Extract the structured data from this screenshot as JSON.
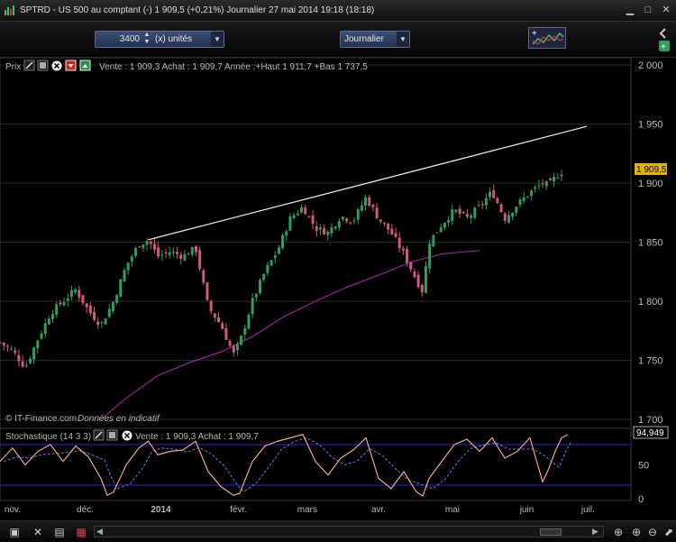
{
  "window": {
    "title": "SPTRD - US 500 au comptant (-)    1 909,5 (+0,21%)    Journalier  27 mai 2014 19:18 (18:18)"
  },
  "toolbar": {
    "quantity": "3400",
    "units_label": "(x) unités",
    "period": "Journalier"
  },
  "price_panel": {
    "label": "Prix",
    "header": "Vente : 1 909,3 Achat : 1 909,7 Année :+Haut 1 911,7 +Bas 1 737,5",
    "last_price": "1 909,5",
    "watermark": "© IT-Finance.com",
    "watermark_note": "Données en indicatif"
  },
  "stoch_panel": {
    "label": "Stochastique (14 3 3)",
    "header": "Vente : 1 909,3 Achat : 1 909,7",
    "last_value": "94,949"
  },
  "colors": {
    "up": "#2e9e5b",
    "down": "#d05a7a",
    "ma": "#9b1f9b",
    "trend": "#e6e6e6",
    "stoch_k": "#f2a58c",
    "stoch_d": "#7070ff",
    "bands": "#2b2bd0"
  },
  "chart_data": [
    {
      "type": "candlestick",
      "series_name": "SPTRD",
      "x_ticks": [
        "nov.",
        "déc.",
        "2014",
        "févr.",
        "mars",
        "avr.",
        "mai",
        "juin",
        "juil."
      ],
      "y_ticks": [
        "2 000",
        "1 950",
        "1 900",
        "1 850",
        "1 800",
        "1 750",
        "1 700"
      ],
      "ylim": [
        1700,
        2000
      ],
      "grid": true,
      "moving_average": [
        [
          0.16,
          1700
        ],
        [
          0.2,
          1718
        ],
        [
          0.25,
          1737
        ],
        [
          0.3,
          1748
        ],
        [
          0.35,
          1757
        ],
        [
          0.4,
          1770
        ],
        [
          0.45,
          1787
        ],
        [
          0.5,
          1800
        ],
        [
          0.55,
          1812
        ],
        [
          0.6,
          1822
        ],
        [
          0.65,
          1833
        ],
        [
          0.7,
          1840
        ],
        [
          0.76,
          1843
        ]
      ],
      "trend_line": [
        [
          0.235,
          1852
        ],
        [
          0.93,
          1948
        ]
      ],
      "close_path": [
        [
          0.0,
          1765
        ],
        [
          0.02,
          1758
        ],
        [
          0.04,
          1744
        ],
        [
          0.06,
          1768
        ],
        [
          0.08,
          1790
        ],
        [
          0.1,
          1800
        ],
        [
          0.12,
          1810
        ],
        [
          0.14,
          1792
        ],
        [
          0.16,
          1780
        ],
        [
          0.18,
          1800
        ],
        [
          0.2,
          1830
        ],
        [
          0.22,
          1848
        ],
        [
          0.235,
          1852
        ],
        [
          0.25,
          1838
        ],
        [
          0.27,
          1842
        ],
        [
          0.29,
          1838
        ],
        [
          0.31,
          1845
        ],
        [
          0.33,
          1795
        ],
        [
          0.35,
          1780
        ],
        [
          0.37,
          1755
        ],
        [
          0.38,
          1765
        ],
        [
          0.4,
          1800
        ],
        [
          0.42,
          1825
        ],
        [
          0.44,
          1843
        ],
        [
          0.46,
          1870
        ],
        [
          0.48,
          1880
        ],
        [
          0.5,
          1862
        ],
        [
          0.52,
          1858
        ],
        [
          0.54,
          1872
        ],
        [
          0.56,
          1868
        ],
        [
          0.58,
          1888
        ],
        [
          0.6,
          1870
        ],
        [
          0.62,
          1858
        ],
        [
          0.64,
          1840
        ],
        [
          0.66,
          1818
        ],
        [
          0.67,
          1808
        ],
        [
          0.68,
          1850
        ],
        [
          0.7,
          1865
        ],
        [
          0.72,
          1877
        ],
        [
          0.74,
          1870
        ],
        [
          0.76,
          1880
        ],
        [
          0.78,
          1893
        ],
        [
          0.8,
          1870
        ],
        [
          0.82,
          1882
        ],
        [
          0.84,
          1892
        ],
        [
          0.86,
          1900
        ],
        [
          0.87,
          1898
        ],
        [
          0.88,
          1905
        ],
        [
          0.89,
          1909.5
        ]
      ]
    },
    {
      "type": "line",
      "series_name": "Stochastique (14 3 3)",
      "y_ticks": [
        "50",
        "0"
      ],
      "bands": [
        80,
        20
      ],
      "last_value": "94,949",
      "k_path": [
        [
          0.0,
          55
        ],
        [
          0.02,
          75
        ],
        [
          0.04,
          50
        ],
        [
          0.06,
          70
        ],
        [
          0.08,
          80
        ],
        [
          0.1,
          55
        ],
        [
          0.12,
          78
        ],
        [
          0.14,
          62
        ],
        [
          0.16,
          30
        ],
        [
          0.17,
          5
        ],
        [
          0.18,
          10
        ],
        [
          0.2,
          50
        ],
        [
          0.22,
          75
        ],
        [
          0.235,
          85
        ],
        [
          0.25,
          65
        ],
        [
          0.27,
          70
        ],
        [
          0.29,
          72
        ],
        [
          0.31,
          85
        ],
        [
          0.33,
          40
        ],
        [
          0.35,
          18
        ],
        [
          0.37,
          5
        ],
        [
          0.38,
          8
        ],
        [
          0.4,
          55
        ],
        [
          0.42,
          78
        ],
        [
          0.44,
          85
        ],
        [
          0.46,
          90
        ],
        [
          0.48,
          95
        ],
        [
          0.5,
          55
        ],
        [
          0.52,
          35
        ],
        [
          0.54,
          60
        ],
        [
          0.56,
          72
        ],
        [
          0.58,
          90
        ],
        [
          0.6,
          30
        ],
        [
          0.62,
          15
        ],
        [
          0.64,
          40
        ],
        [
          0.66,
          10
        ],
        [
          0.67,
          4
        ],
        [
          0.68,
          30
        ],
        [
          0.7,
          55
        ],
        [
          0.72,
          80
        ],
        [
          0.74,
          88
        ],
        [
          0.76,
          70
        ],
        [
          0.78,
          90
        ],
        [
          0.8,
          60
        ],
        [
          0.82,
          70
        ],
        [
          0.84,
          90
        ],
        [
          0.86,
          25
        ],
        [
          0.87,
          45
        ],
        [
          0.88,
          70
        ],
        [
          0.89,
          90
        ],
        [
          0.9,
          94.9
        ]
      ]
    }
  ],
  "bottombar": {
    "icons": [
      "new-window-icon",
      "close-icon",
      "chart-list-icon",
      "settings-icon",
      "scroll-left-icon",
      "scroll-right-icon",
      "zoom-fit-icon",
      "zoom-in-icon",
      "zoom-out-icon",
      "drawing-icon"
    ]
  }
}
